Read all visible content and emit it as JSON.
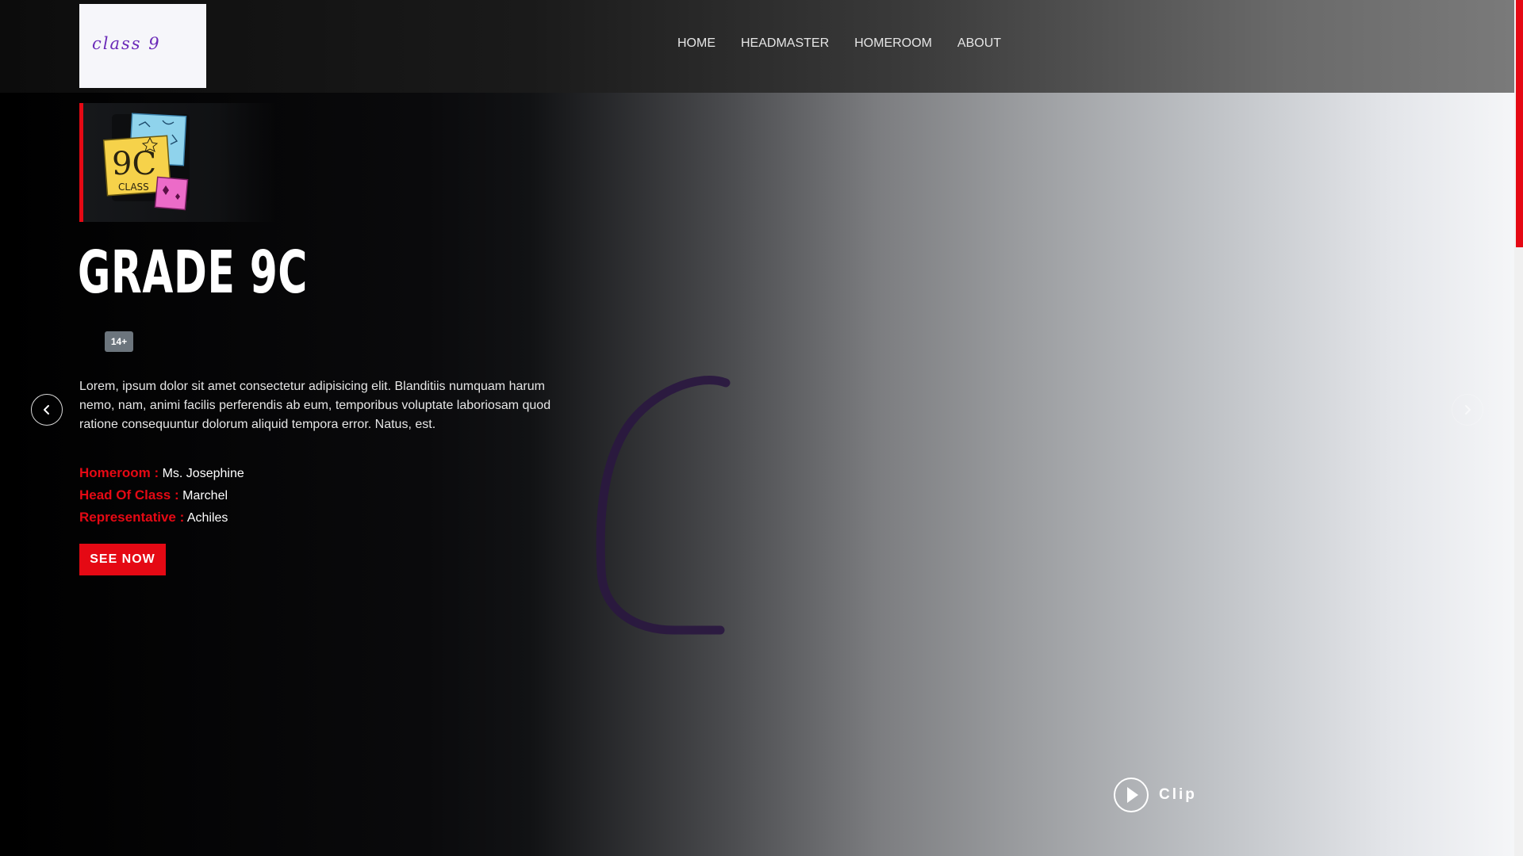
{
  "header": {
    "logo_text": "class 9",
    "nav": [
      "HOME",
      "HEADMASTER",
      "HOMEROOM",
      "ABOUT"
    ]
  },
  "hero": {
    "emblem": {
      "big_text": "9C",
      "sub_text": "CLASS"
    },
    "title": "GRADE 9C",
    "age_badge": "14+",
    "description": "Lorem, ipsum dolor sit amet consectetur adipisicing elit. Blanditiis numquam harum nemo, nam, animi facilis perferendis ab eum, temporibus voluptate laboriosam quod ratione consequuntur dolorum aliquid tempora error. Natus, est.",
    "info": [
      {
        "key": "Homeroom :",
        "value": "Ms. Josephine"
      },
      {
        "key": "Head Of Class :",
        "value": "Marchel"
      },
      {
        "key": "Representative :",
        "value": "Achiles"
      }
    ],
    "cta": "SEE NOW",
    "clip_label": "Clip"
  },
  "colors": {
    "accent": "#e50914",
    "badge": "#6c757d",
    "logo_ink": "#6a2ab8",
    "c_stroke": "#2a1840"
  },
  "icons": {
    "prev": "chevron-left-icon",
    "next": "chevron-right-icon",
    "play": "play-icon"
  }
}
